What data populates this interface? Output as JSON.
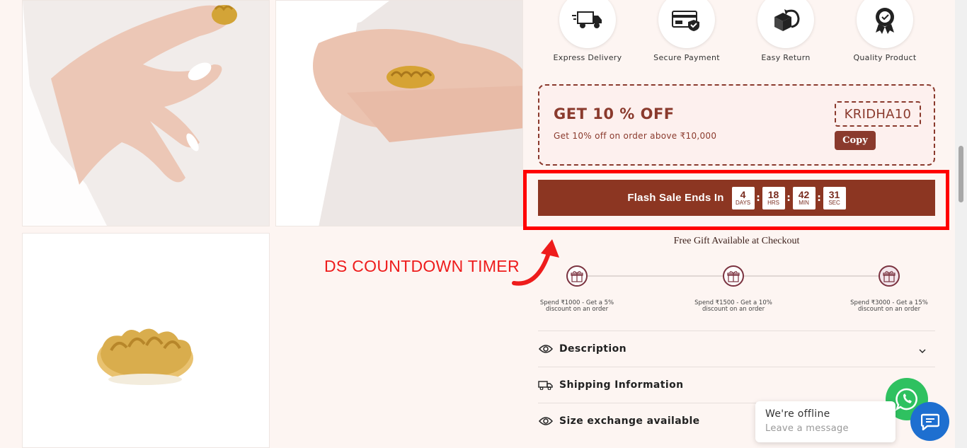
{
  "features": [
    {
      "label": "Express Delivery",
      "icon": "delivery-truck-icon"
    },
    {
      "label": "Secure Payment",
      "icon": "credit-card-shield-icon"
    },
    {
      "label": "Easy Return",
      "icon": "box-return-icon"
    },
    {
      "label": "Quality Product",
      "icon": "quality-badge-icon"
    }
  ],
  "coupon": {
    "title": "GET 10 % OFF",
    "subtitle": "Get 10% off on order above ₹10,000",
    "code": "KRIDHA10",
    "copy_label": "Copy"
  },
  "flash_sale": {
    "title": "Flash Sale Ends In",
    "days": "4",
    "days_unit": "DAYS",
    "hrs": "18",
    "hrs_unit": "HRS",
    "min": "42",
    "min_unit": "MIN",
    "sec": "31",
    "sec_unit": "SEC",
    "separator": ":"
  },
  "free_gift": "Free Gift Available at Checkout",
  "annotation": "DS COUNTDOWN TIMER",
  "tiers": [
    "Spend ₹1000 - Get a 5% discount on an order",
    "Spend ₹1500 - Get a 10% discount on an order",
    "Spend ₹3000 - Get a 15% discount on an order"
  ],
  "accordion": [
    {
      "label": "Description",
      "icon": "eye-icon"
    },
    {
      "label": "Shipping Information",
      "icon": "truck-icon"
    },
    {
      "label": "Size exchange available",
      "icon": "eye-icon"
    }
  ],
  "chat": {
    "status": "We're offline",
    "placeholder": "Leave a message"
  },
  "colors": {
    "brand": "#8c3622",
    "annotation": "#ff0000",
    "whatsapp": "#2fc160",
    "chat": "#1e6fd0"
  }
}
